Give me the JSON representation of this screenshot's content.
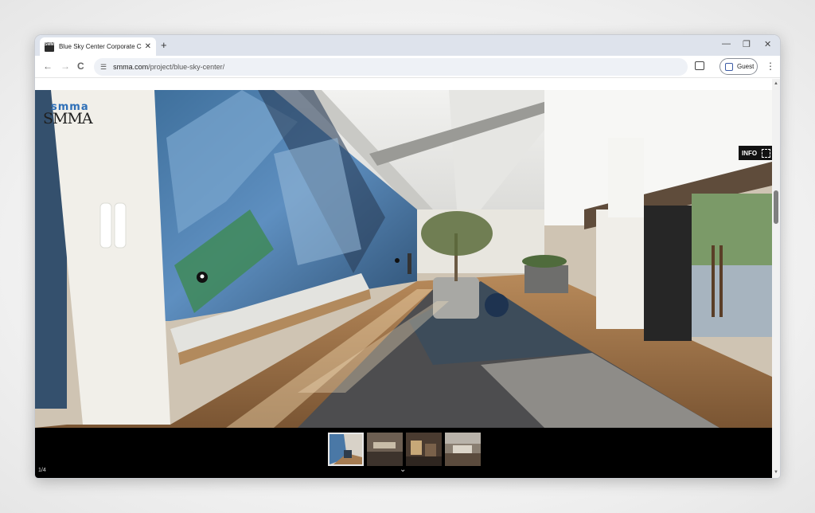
{
  "browser": {
    "tab_title": "Blue Sky Center Corporate Campus",
    "tab_close": "✕",
    "new_tab": "+",
    "favicon_text": "SMMA",
    "window_controls": {
      "minimize": "—",
      "maximize": "❐",
      "close": "✕"
    },
    "nav": {
      "back": "←",
      "forward": "→",
      "reload": "C"
    },
    "url_host": "smma.com",
    "url_path": "/project/blue-sky-center/",
    "profile_label": "Guest",
    "menu": "⋮"
  },
  "viewer": {
    "logo_top": "smma",
    "logo_main": "SMMA",
    "info_label": "INFO",
    "counter": "1/4",
    "chevron": "⌄"
  },
  "colors": {
    "tabstrip": "#dee3ec",
    "accent_blue": "#2e6fb7",
    "viewer_bg": "#000000"
  }
}
